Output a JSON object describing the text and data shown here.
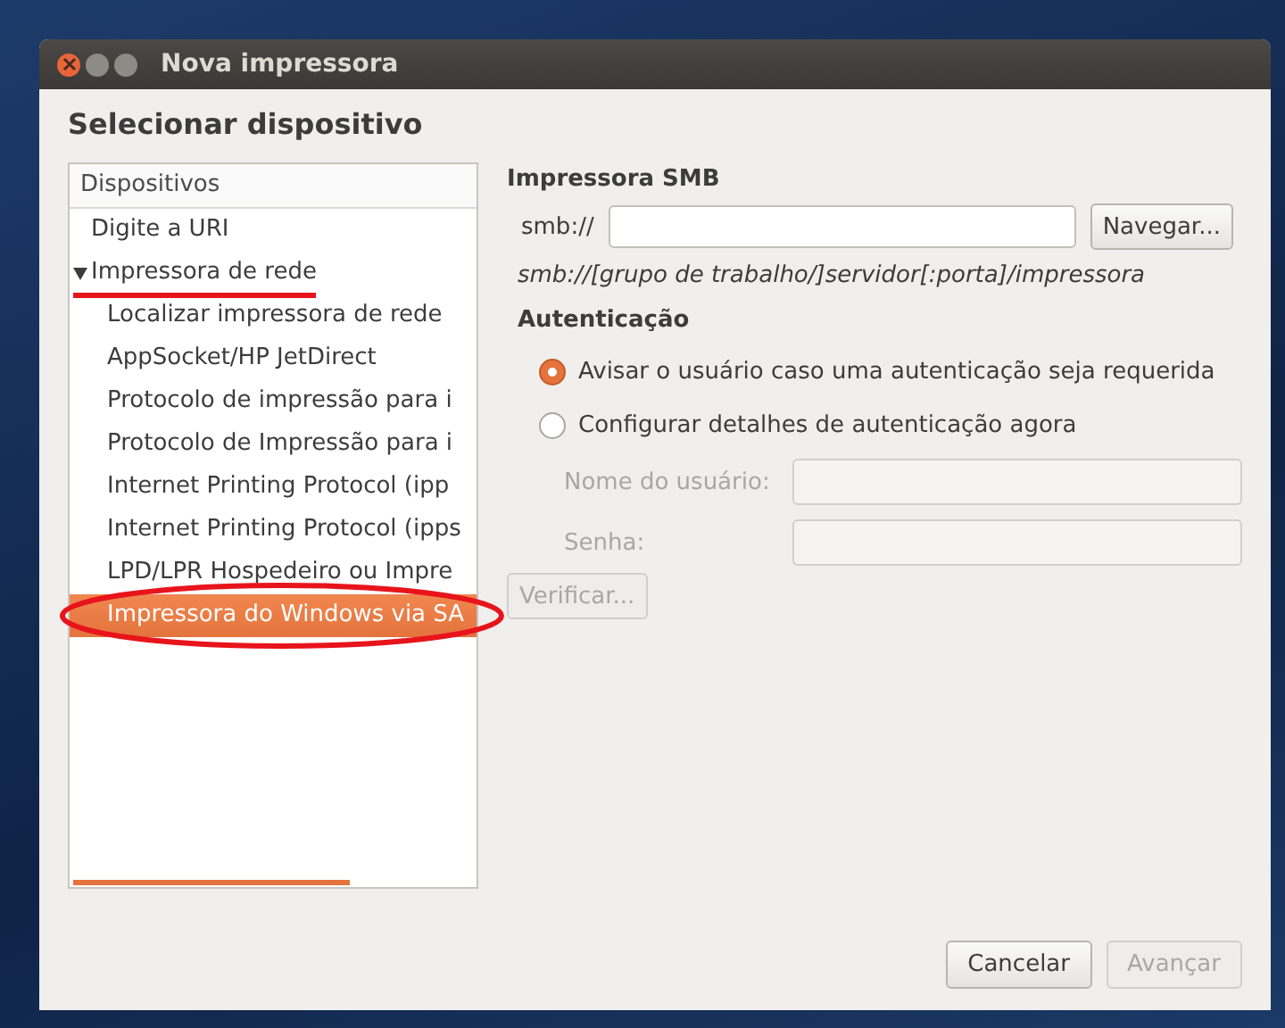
{
  "window": {
    "title": "Nova impressora"
  },
  "heading": "Selecionar dispositivo",
  "devices": {
    "header": "Dispositivos",
    "items": [
      {
        "label": "Digite a URI",
        "selected": false
      },
      {
        "label": "Impressora de rede",
        "selected": false,
        "expanded": true,
        "underlined": true,
        "children": [
          {
            "label": "Localizar impressora de rede",
            "selected": false
          },
          {
            "label": "AppSocket/HP JetDirect",
            "selected": false
          },
          {
            "label": "Protocolo de impressão para i",
            "selected": false
          },
          {
            "label": "Protocolo de Impressão para i",
            "selected": false
          },
          {
            "label": "Internet Printing Protocol (ipp",
            "selected": false
          },
          {
            "label": "Internet Printing Protocol (ipps",
            "selected": false
          },
          {
            "label": "LPD/LPR Hospedeiro ou Impre",
            "selected": false
          },
          {
            "label": "Impressora do Windows via SA",
            "selected": true,
            "circled": true
          }
        ]
      }
    ]
  },
  "smb": {
    "title": "Impressora SMB",
    "prefix": "smb://",
    "browse_button": "Navegar...",
    "hint": "smb://[grupo de trabalho/]servidor[:porta]/impressora"
  },
  "auth": {
    "title": "Autenticação",
    "options": [
      {
        "label": "Avisar o usuário caso uma autenticação seja requerida",
        "selected": true
      },
      {
        "label": "Configurar detalhes de autenticação agora",
        "selected": false
      }
    ],
    "fields": [
      {
        "label": "Nome do usuário:",
        "disabled": true
      },
      {
        "label": "Senha:",
        "disabled": true
      }
    ],
    "verify_button": {
      "label": "Verificar...",
      "disabled": true
    }
  },
  "buttons": [
    {
      "label": "Cancelar",
      "disabled": false
    },
    {
      "label": "Avançar",
      "disabled": true
    }
  ]
}
